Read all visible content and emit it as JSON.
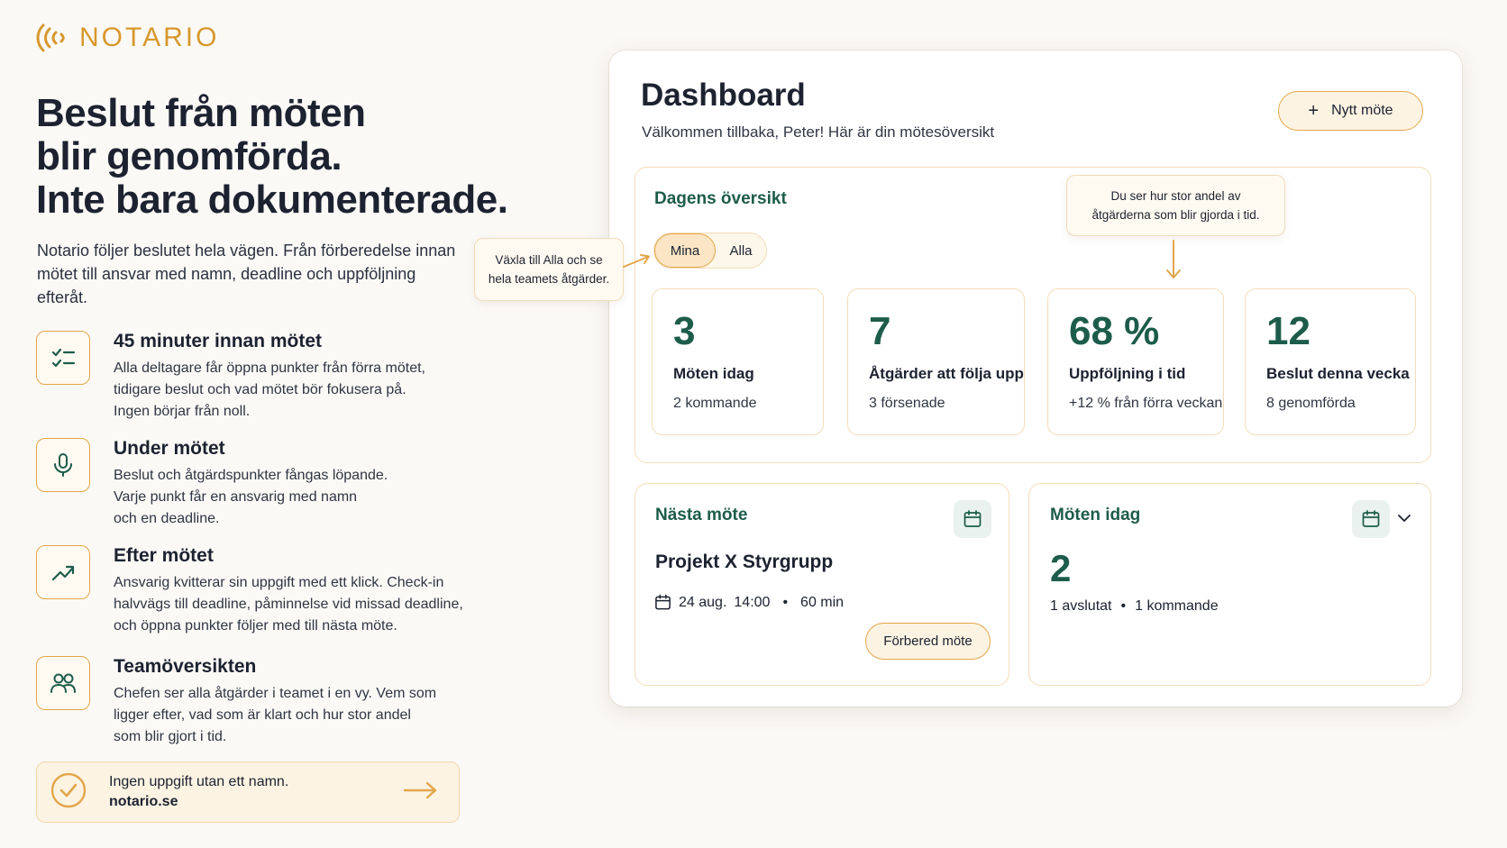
{
  "brand": {
    "name": "NOTARIO"
  },
  "hero": {
    "title_lines": [
      "Beslut från möten",
      "blir genomförda.",
      "Inte bara dokumenterade."
    ],
    "subtitle": "Notario följer beslutet hela vägen. Från förberedelse innan mötet till ansvar med namn, deadline och uppföljning efteråt."
  },
  "features": [
    {
      "icon": "checklist-icon",
      "title": "45 minuter innan mötet",
      "lines": [
        "Alla deltagare får öppna punkter från förra mötet,",
        "tidigare beslut och vad mötet bör fokusera på.",
        "Ingen börjar från noll."
      ]
    },
    {
      "icon": "microphone-icon",
      "title": "Under mötet",
      "lines": [
        "Beslut och åtgärdspunkter fångas löpande.",
        "Varje punkt får en ansvarig med namn",
        "och en deadline."
      ]
    },
    {
      "icon": "trend-up-icon",
      "title": "Efter mötet",
      "lines": [
        "Ansvarig kvitterar sin uppgift med ett klick. Check-in",
        "halvvägs till deadline, påminnelse vid missad deadline,",
        "och öppna punkter följer med till nästa möte."
      ]
    },
    {
      "icon": "team-icon",
      "title": "Teamöversikten",
      "lines": [
        "Chefen ser alla åtgärder i teamet i en vy. Vem som",
        "ligger efter, vad som är klart och hur stor andel",
        "som blir gjort i tid."
      ]
    }
  ],
  "cta": {
    "line1": "Ingen uppgift utan ett namn.",
    "line2": "notario.se"
  },
  "dashboard": {
    "title": "Dashboard",
    "welcome": "Välkommen tillbaka, Peter! Här är din mötesöversikt",
    "new_meeting_label": "Nytt möte",
    "overview": {
      "heading": "Dagens översikt",
      "toggle": {
        "selected": "Mina",
        "other": "Alla"
      },
      "stats": [
        {
          "value": "3",
          "label": "Möten idag",
          "sub": "2 kommande"
        },
        {
          "value": "7",
          "label": "Åtgärder att följa upp",
          "sub": "3 försenade"
        },
        {
          "value": "68 %",
          "label": "Uppföljning i tid",
          "sub": "+12 % från förra veckan"
        },
        {
          "value": "12",
          "label": "Beslut denna vecka",
          "sub": "8 genomförda"
        }
      ]
    },
    "tooltips": {
      "toggle_hint": [
        "Växla till Alla och se",
        "hela teamets åtgärder."
      ],
      "followup_hint": [
        "Du ser hur stor andel av",
        "åtgärderna som blir gjorda i tid."
      ]
    },
    "next_meeting": {
      "heading": "Nästa möte",
      "name": "Projekt X Styrgrupp",
      "date": "24 aug.",
      "time": "14:00",
      "duration": "60 min",
      "prepare_label": "Förbered möte"
    },
    "meetings_today": {
      "heading": "Möten idag",
      "count": "2",
      "finished": "1 avslutat",
      "upcoming": "1 kommande"
    }
  },
  "colors": {
    "accent": "#e2a64a",
    "brand": "#d7982c",
    "primary_text": "#1c2230",
    "green": "#1d5c4a"
  }
}
